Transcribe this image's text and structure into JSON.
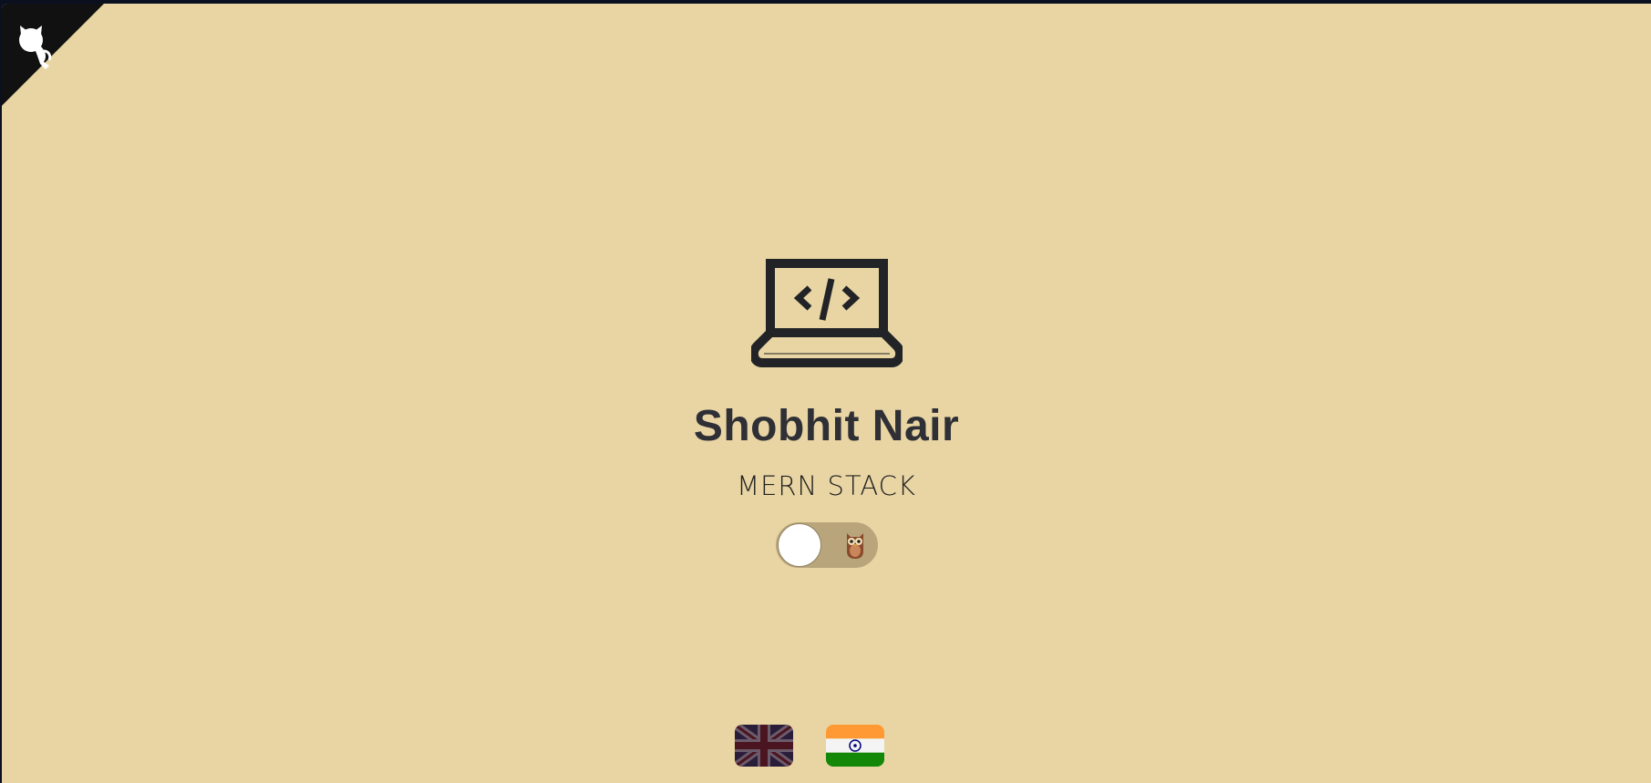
{
  "profile": {
    "name": "Shobhit Nair",
    "role": "MERN STACK"
  },
  "theme_toggle": {
    "state": "off",
    "icon": "owl-icon"
  },
  "corner_link": {
    "icon": "github-octocat-icon"
  },
  "languages": [
    {
      "icon": "uk-flag-icon"
    },
    {
      "icon": "india-flag-icon"
    }
  ],
  "colors": {
    "page_background": "#e8d5a3",
    "text_dark": "#2f2f36",
    "corner_black": "#111111",
    "toggle_track": "#b8a57c"
  }
}
